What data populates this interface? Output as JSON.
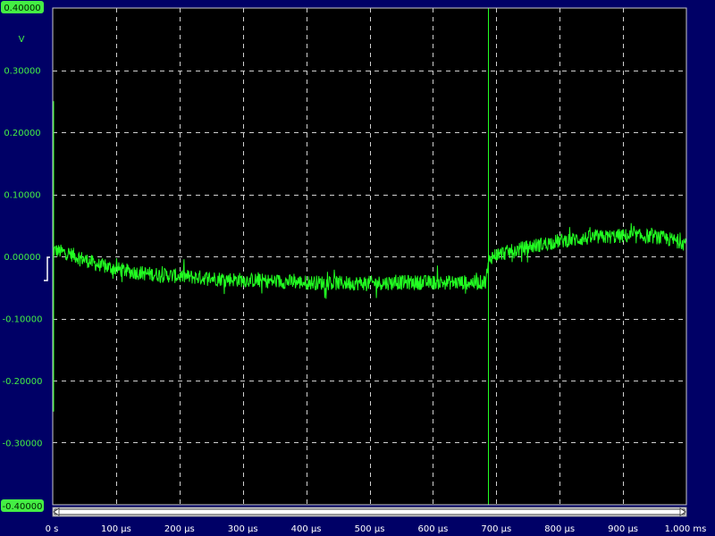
{
  "colors": {
    "background": "#000066",
    "plot_background": "#000000",
    "grid": "#d0d0d0",
    "trace": "#22ff22",
    "cursor": "#22ff22",
    "axis_text": "#ffffff",
    "level_text": "#44ee44"
  },
  "chart_data": {
    "type": "line",
    "title": "",
    "y_unit": "V",
    "ylim": [
      -0.4,
      0.4
    ],
    "xlim": [
      0,
      1000
    ],
    "x_unit": "µs",
    "grid": "dashed",
    "y_max_label": "0.40000",
    "y_min_label": "-0.40000",
    "y_tick_labels": [
      {
        "value": 0.3,
        "label": "0.30000"
      },
      {
        "value": 0.2,
        "label": "0.20000"
      },
      {
        "value": 0.1,
        "label": "0.10000"
      },
      {
        "value": 0.0,
        "label": "0.00000"
      },
      {
        "value": -0.1,
        "label": "-0.10000"
      },
      {
        "value": -0.2,
        "label": "-0.20000"
      },
      {
        "value": -0.3,
        "label": "-0.30000"
      }
    ],
    "x_tick_labels": [
      {
        "value": 0,
        "label": "0 s"
      },
      {
        "value": 100,
        "label": "100 µs"
      },
      {
        "value": 200,
        "label": "200 µs"
      },
      {
        "value": 300,
        "label": "300 µs"
      },
      {
        "value": 400,
        "label": "400 µs"
      },
      {
        "value": 500,
        "label": "500 µs"
      },
      {
        "value": 600,
        "label": "600 µs"
      },
      {
        "value": 700,
        "label": "700 µs"
      },
      {
        "value": 800,
        "label": "800 µs"
      },
      {
        "value": 900,
        "label": "900 µs"
      },
      {
        "value": 1000,
        "label": "1.000 ms"
      }
    ],
    "series": [
      {
        "x": [
          0,
          25,
          50,
          75,
          100,
          125,
          150,
          175,
          200,
          250,
          300,
          350,
          400,
          450,
          500,
          550,
          600,
          650,
          675,
          683,
          690,
          700,
          725,
          750,
          775,
          800,
          850,
          900,
          950,
          1000
        ],
        "y": [
          0.01,
          0.005,
          -0.005,
          -0.015,
          -0.02,
          -0.025,
          -0.028,
          -0.03,
          -0.032,
          -0.035,
          -0.038,
          -0.04,
          -0.042,
          -0.043,
          -0.043,
          -0.042,
          -0.042,
          -0.042,
          -0.042,
          -0.04,
          -0.002,
          0.003,
          0.008,
          0.015,
          0.02,
          0.025,
          0.03,
          0.033,
          0.032,
          0.022
        ],
        "noise_amplitude": 0.012
      }
    ],
    "trigger_spike": {
      "x": 0,
      "y_max": 0.25,
      "y_min": -0.25
    },
    "cursor_x": 687,
    "zero_level": 0.0
  }
}
